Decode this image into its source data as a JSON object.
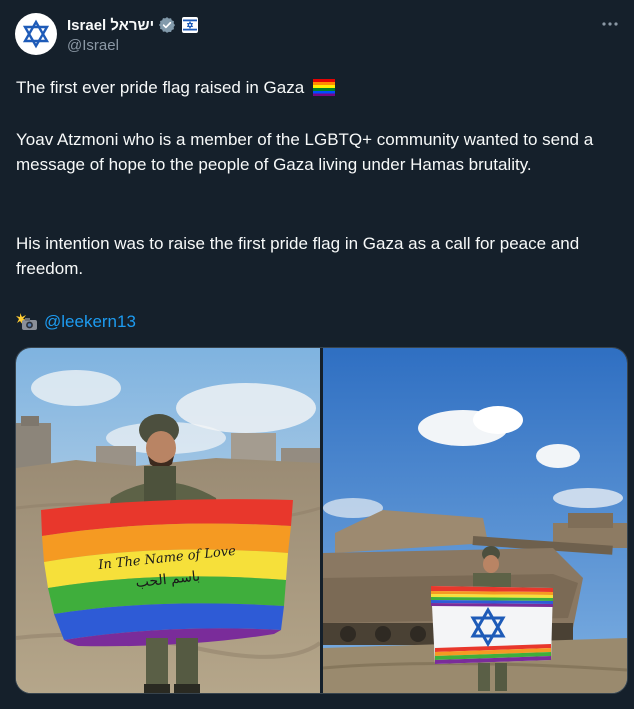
{
  "author": {
    "display_name": "Israel ישראל",
    "handle": "@Israel",
    "avatar_icon": "star-of-david-icon",
    "verified_icon": "gray-verified-badge-icon",
    "affiliation_icon": "israel-flag-badge-icon"
  },
  "menu": {
    "more_icon": "more-horizontal-icon"
  },
  "tweet": {
    "line1": "The first ever pride flag raised in Gaza",
    "line1_emoji": "rainbow-flag-emoji",
    "paragraph2": "Yoav Atzmoni who is a member of the LGBTQ+ community wanted to send a message of hope to the people of Gaza living under Hamas brutality.",
    "paragraph3": "His intention was to raise the first pride flag in Gaza as a call for peace and freedom.",
    "credit_emoji": "camera-flash-emoji",
    "credit_mention": "@leekern13"
  },
  "media": [
    {
      "name": "photo-soldier-with-pride-flag",
      "flag_text": "In The Name of Love",
      "flag_text_arabic": "باسم الحب"
    },
    {
      "name": "photo-soldier-with-tanks"
    }
  ],
  "colors": {
    "background": "#15202b",
    "text": "#f7f9f9",
    "secondary": "#8b98a5",
    "link": "#1d9bf0"
  }
}
